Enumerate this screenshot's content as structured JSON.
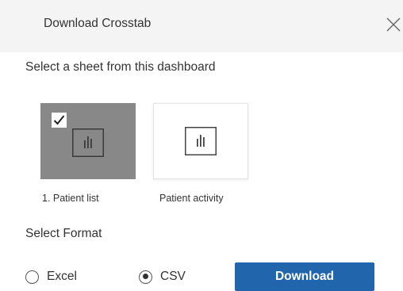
{
  "dialog": {
    "title": "Download Crosstab",
    "close_icon": "close-icon",
    "subtitle": "Select a sheet from this dashboard"
  },
  "sheets": [
    {
      "label": "1. Patient list",
      "selected": true,
      "icon": "bar-chart-icon"
    },
    {
      "label": "Patient activity",
      "selected": false,
      "icon": "bar-chart-icon"
    }
  ],
  "format": {
    "label": "Select Format",
    "options": [
      {
        "label": "Excel",
        "selected": false
      },
      {
        "label": "CSV",
        "selected": true
      }
    ]
  },
  "actions": {
    "download_label": "Download"
  },
  "colors": {
    "accent": "#2165ad",
    "selected_tile": "#888888",
    "header_bg": "#f4f4f4"
  }
}
